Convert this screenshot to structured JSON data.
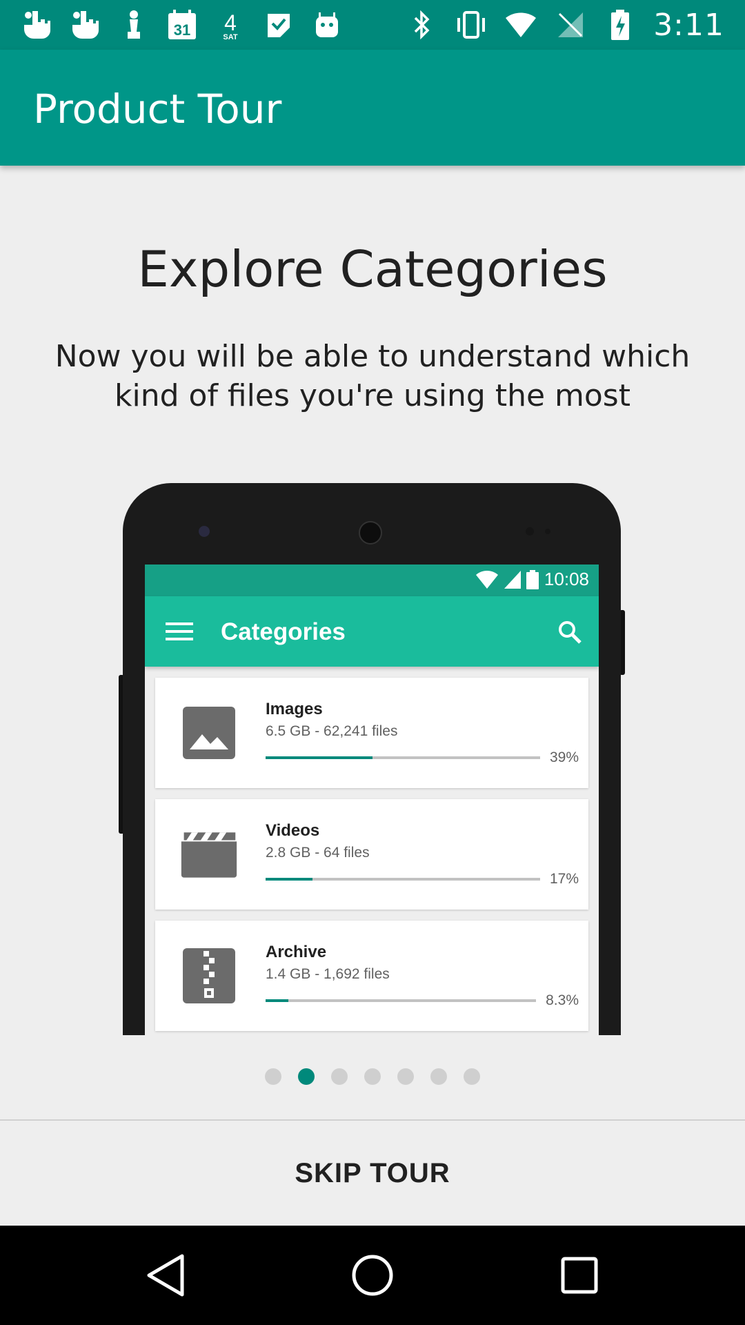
{
  "status_bar": {
    "time": "3:11",
    "left_icons": [
      "hand-icon",
      "hand-icon",
      "chess-icon",
      "calendar-icon",
      "weather-icon",
      "check-icon",
      "android-icon"
    ],
    "calendar_day": "31",
    "weather_day": "4",
    "weather_label": "SAT"
  },
  "app_bar": {
    "title": "Product Tour"
  },
  "tour": {
    "headline": "Explore Categories",
    "description": "Now you will be able to understand which kind of files you're using the most"
  },
  "mockup": {
    "status_time": "10:08",
    "app_title": "Categories",
    "categories": [
      {
        "name": "Images",
        "meta": "6.5 GB - 62,241 files",
        "percent_label": "39%",
        "fraction": 0.39,
        "icon": "image-icon"
      },
      {
        "name": "Videos",
        "meta": "2.8 GB - 64 files",
        "percent_label": "17%",
        "fraction": 0.17,
        "icon": "video-icon"
      },
      {
        "name": "Archive",
        "meta": "1.4 GB - 1,692 files",
        "percent_label": "8.3%",
        "fraction": 0.083,
        "icon": "archive-icon"
      }
    ]
  },
  "pager": {
    "total": 7,
    "active_index": 1
  },
  "footer": {
    "skip_label": "SKIP TOUR"
  },
  "colors": {
    "primary": "#009688",
    "primary_dark": "#00897b",
    "mock_accent": "#1abc9c"
  }
}
